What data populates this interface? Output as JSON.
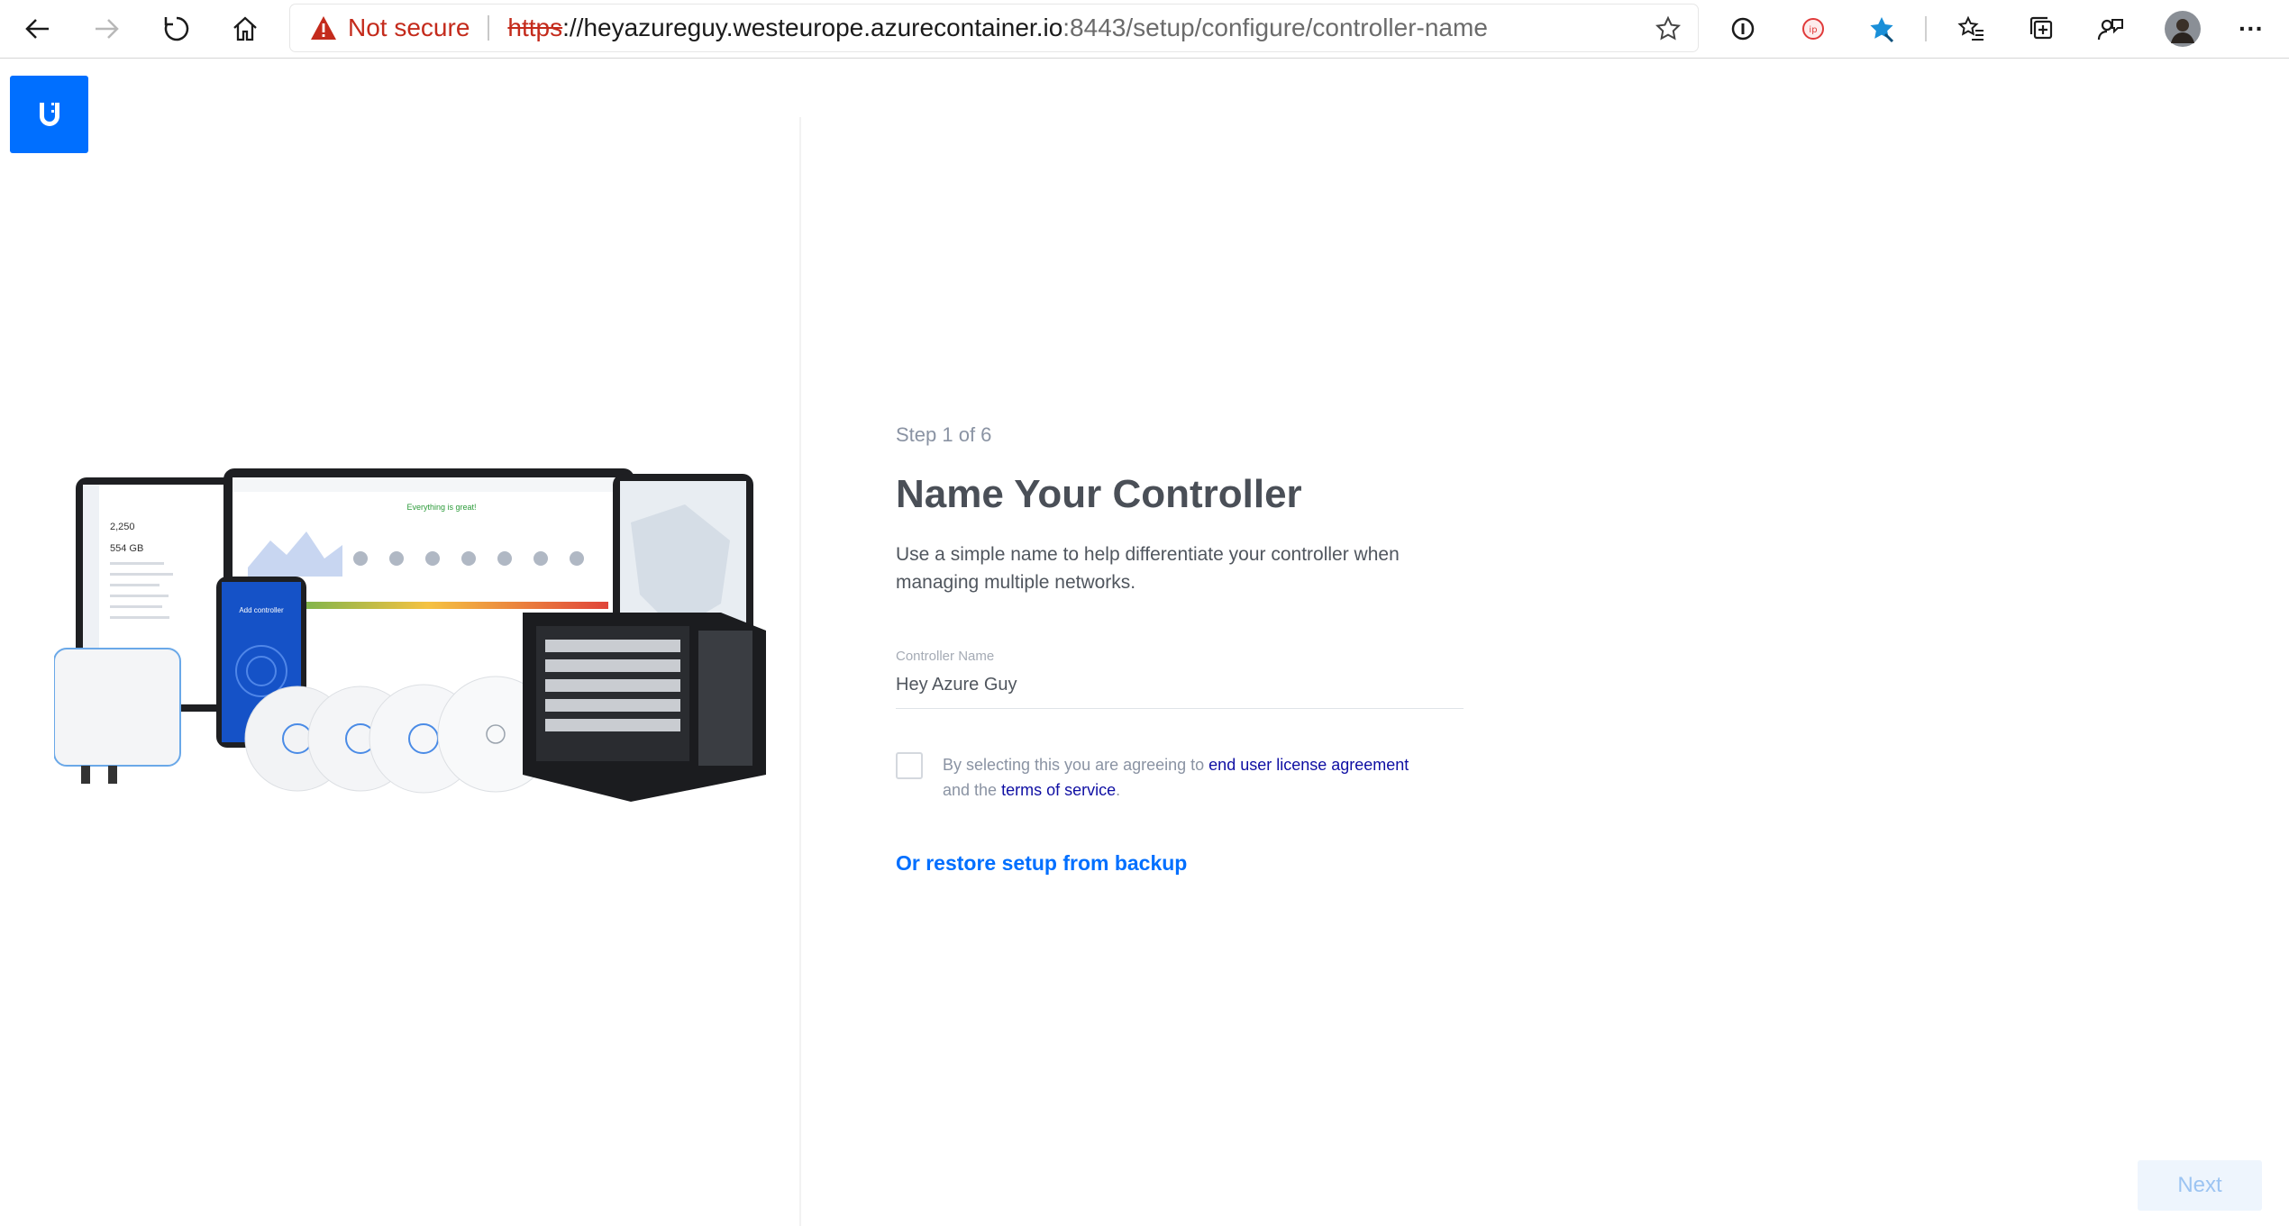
{
  "browser": {
    "security_label": "Not secure",
    "url_scheme": "https",
    "url_separator": "://",
    "url_host": "heyazureguy.westeurope.azurecontainer.io",
    "url_rest": ":8443/setup/configure/controller-name",
    "more_label": "···"
  },
  "colors": {
    "brand": "#006fff",
    "warning": "#c42b1c",
    "link": "#0f0fa3"
  },
  "setup": {
    "step": "Step 1 of 6",
    "title": "Name Your Controller",
    "description": "Use a simple name to help differentiate your controller when managing multiple networks.",
    "field_label": "Controller Name",
    "field_value": "Hey Azure Guy",
    "agree_prefix": "By selecting this you are agreeing to ",
    "eula_link": "end user license agreement",
    "agree_middle": " and the ",
    "tos_link": "terms of service",
    "agree_suffix": ".",
    "restore_link": "Or restore setup from backup",
    "next_label": "Next"
  },
  "hero": {
    "tablet_value_1": "2,250",
    "tablet_value_2": "554 GB",
    "laptop_banner": "Everything is great!",
    "phone_title": "Add controller"
  }
}
